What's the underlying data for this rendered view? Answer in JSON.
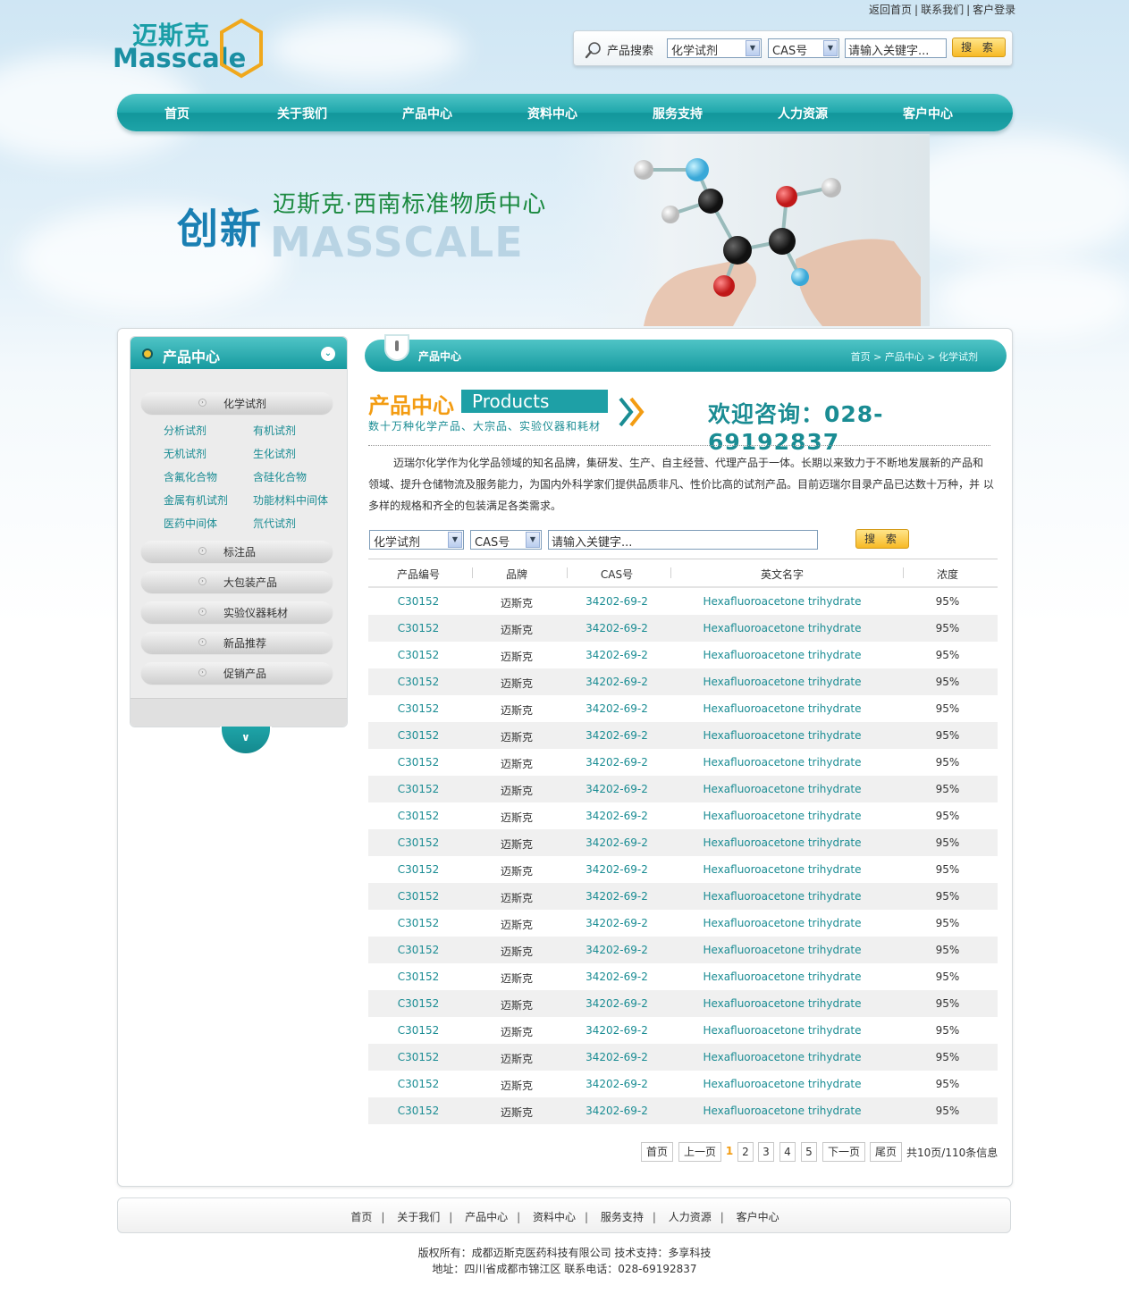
{
  "top_links": [
    "返回首页",
    "联系我们",
    "客户登录"
  ],
  "logo": {
    "cn": "迈斯克",
    "en": "Masscale"
  },
  "header_search": {
    "label": "产品搜索",
    "category": "化学试剂",
    "field": "CAS号",
    "placeholder": "请输入关键字...",
    "button": "搜 索"
  },
  "nav": [
    "首页",
    "关于我们",
    "产品中心",
    "资料中心",
    "服务支持",
    "人力资源",
    "客户中心"
  ],
  "banner": {
    "word": "创新",
    "title": "迈斯克·西南标准物质中心",
    "subtitle": "MASSCALE"
  },
  "sidebar": {
    "title": "产品中心",
    "categories": [
      {
        "label": "化学试剂"
      },
      {
        "label": "标注品"
      },
      {
        "label": "大包装产品"
      },
      {
        "label": "实验仪器耗材"
      },
      {
        "label": "新品推荐"
      },
      {
        "label": "促销产品"
      }
    ],
    "subitems": [
      "分析试剂",
      "有机试剂",
      "无机试剂",
      "生化试剂",
      "含氟化合物",
      "含硅化合物",
      "金属有机试剂",
      "功能材料中间体",
      "医药中间体",
      "氘代试剂"
    ]
  },
  "content": {
    "title": "产品中心",
    "breadcrumb": "首页 > 产品中心 > 化学试剂",
    "promo_cn": "产品中心",
    "promo_en": "Products",
    "promo_sub": "数十万种化学产品、大宗品、实验仪器和耗材",
    "promo_tel": "欢迎咨询：028-69192837",
    "intro": "迈瑞尔化学作为化学品领域的知名品牌，集研发、生产、自主经营、代理产品于一体。长期以来致力于不断地发展新的产品和 领域、提升仓储物流及服务能力，为国内外科学家们提供品质非凡、性价比高的试剂产品。目前迈瑞尔目录产品已达数十万种，并 以多样的规格和齐全的包装满足各类需求。",
    "search": {
      "category": "化学试剂",
      "field": "CAS号",
      "placeholder": "请输入关键字...",
      "button": "搜 索"
    }
  },
  "table": {
    "headers": [
      "产品编号",
      "品牌",
      "CAS号",
      "英文名字",
      "浓度"
    ],
    "rows": [
      [
        "C30152",
        "迈斯克",
        "34202-69-2",
        "Hexafluoroacetone trihydrate",
        "95%"
      ],
      [
        "C30152",
        "迈斯克",
        "34202-69-2",
        "Hexafluoroacetone trihydrate",
        "95%"
      ],
      [
        "C30152",
        "迈斯克",
        "34202-69-2",
        "Hexafluoroacetone trihydrate",
        "95%"
      ],
      [
        "C30152",
        "迈斯克",
        "34202-69-2",
        "Hexafluoroacetone trihydrate",
        "95%"
      ],
      [
        "C30152",
        "迈斯克",
        "34202-69-2",
        "Hexafluoroacetone trihydrate",
        "95%"
      ],
      [
        "C30152",
        "迈斯克",
        "34202-69-2",
        "Hexafluoroacetone trihydrate",
        "95%"
      ],
      [
        "C30152",
        "迈斯克",
        "34202-69-2",
        "Hexafluoroacetone trihydrate",
        "95%"
      ],
      [
        "C30152",
        "迈斯克",
        "34202-69-2",
        "Hexafluoroacetone trihydrate",
        "95%"
      ],
      [
        "C30152",
        "迈斯克",
        "34202-69-2",
        "Hexafluoroacetone trihydrate",
        "95%"
      ],
      [
        "C30152",
        "迈斯克",
        "34202-69-2",
        "Hexafluoroacetone trihydrate",
        "95%"
      ],
      [
        "C30152",
        "迈斯克",
        "34202-69-2",
        "Hexafluoroacetone trihydrate",
        "95%"
      ],
      [
        "C30152",
        "迈斯克",
        "34202-69-2",
        "Hexafluoroacetone trihydrate",
        "95%"
      ],
      [
        "C30152",
        "迈斯克",
        "34202-69-2",
        "Hexafluoroacetone trihydrate",
        "95%"
      ],
      [
        "C30152",
        "迈斯克",
        "34202-69-2",
        "Hexafluoroacetone trihydrate",
        "95%"
      ],
      [
        "C30152",
        "迈斯克",
        "34202-69-2",
        "Hexafluoroacetone trihydrate",
        "95%"
      ],
      [
        "C30152",
        "迈斯克",
        "34202-69-2",
        "Hexafluoroacetone trihydrate",
        "95%"
      ],
      [
        "C30152",
        "迈斯克",
        "34202-69-2",
        "Hexafluoroacetone trihydrate",
        "95%"
      ],
      [
        "C30152",
        "迈斯克",
        "34202-69-2",
        "Hexafluoroacetone trihydrate",
        "95%"
      ],
      [
        "C30152",
        "迈斯克",
        "34202-69-2",
        "Hexafluoroacetone trihydrate",
        "95%"
      ],
      [
        "C30152",
        "迈斯克",
        "34202-69-2",
        "Hexafluoroacetone trihydrate",
        "95%"
      ]
    ]
  },
  "pager": {
    "first": "首页",
    "prev": "上一页",
    "pages": [
      "1",
      "2",
      "3",
      "4",
      "5"
    ],
    "current": "1",
    "next": "下一页",
    "last": "尾页",
    "info": "共10页/110条信息"
  },
  "footer": {
    "nav": [
      "首页",
      "关于我们",
      "产品中心",
      "资料中心",
      "服务支持",
      "人力资源",
      "客户中心"
    ],
    "copyright": "版权所有：成都迈斯克医药科技有限公司 技术支持：多享科技",
    "address": "地址：四川省成都市锦江区 联系电话：028-69192837"
  },
  "colors": {
    "accent": "#1ea4a8",
    "link": "#1a8c93",
    "highlight": "#f39c12"
  }
}
